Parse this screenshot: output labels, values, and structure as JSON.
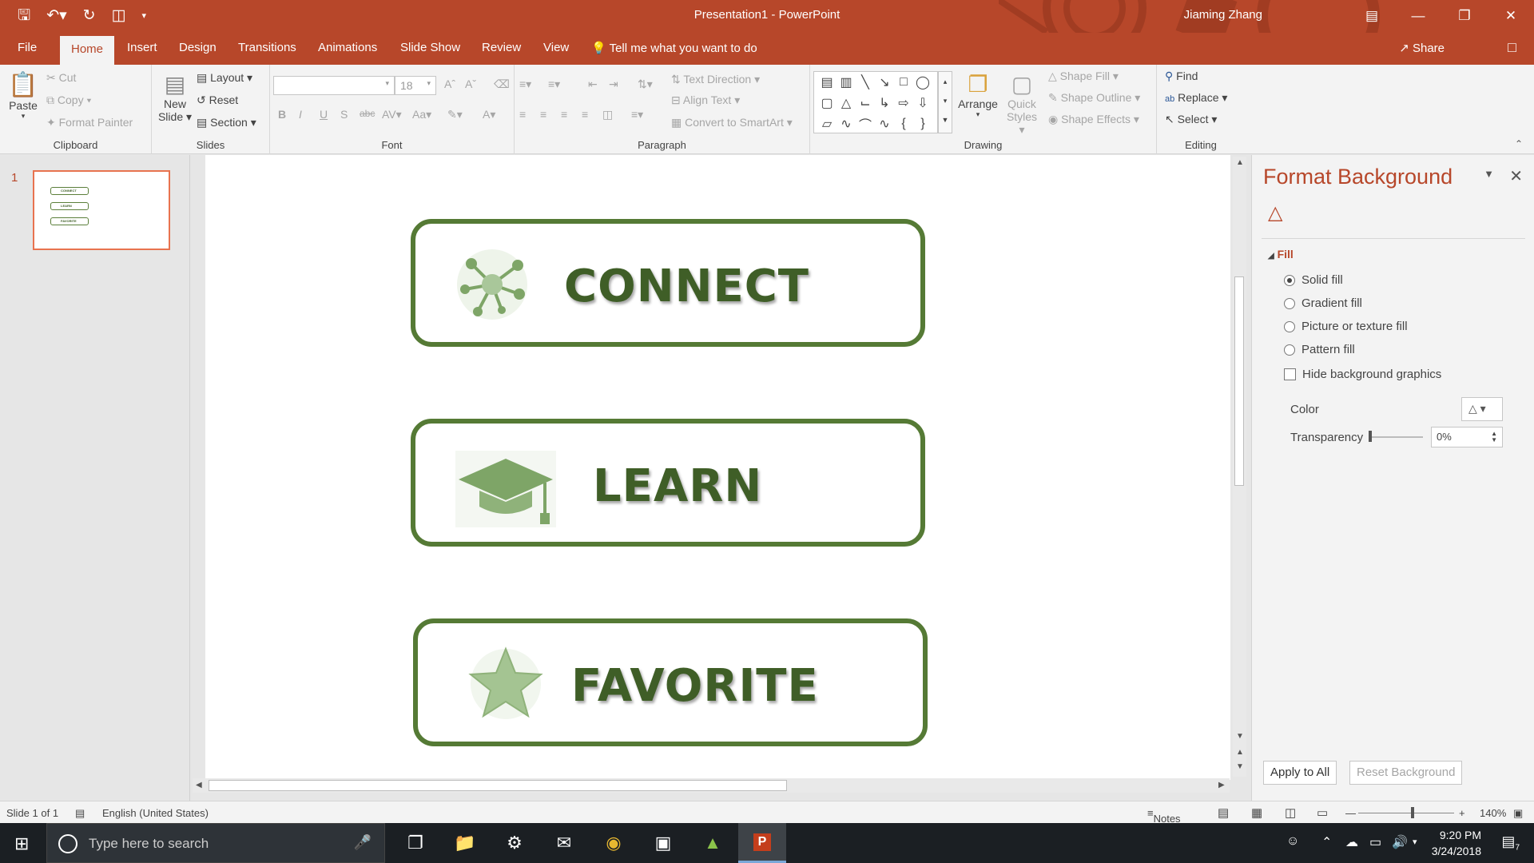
{
  "titlebar": {
    "title": "Presentation1  -  PowerPoint",
    "user": "Jiaming Zhang",
    "quick_access": [
      "save-icon",
      "undo-icon",
      "redo-icon",
      "start-from-beginning-icon",
      "customize-icon"
    ],
    "window_controls": [
      "ribbon-display-icon",
      "minimize-icon",
      "restore-icon",
      "close-icon"
    ]
  },
  "tabs": [
    "File",
    "Home",
    "Insert",
    "Design",
    "Transitions",
    "Animations",
    "Slide Show",
    "Review",
    "View"
  ],
  "active_tab": "Home",
  "tellme": "Tell me what you want to do",
  "share": "Share",
  "ribbon": {
    "clipboard": {
      "label": "Clipboard",
      "paste": "Paste",
      "cut": "Cut",
      "copy": "Copy",
      "format_painter": "Format Painter"
    },
    "slides": {
      "label": "Slides",
      "new_slide_1": "New",
      "new_slide_2": "Slide",
      "layout": "Layout",
      "reset": "Reset",
      "section": "Section"
    },
    "font": {
      "label": "Font",
      "font_name": "",
      "font_size": "18"
    },
    "paragraph": {
      "label": "Paragraph",
      "text_direction": "Text Direction",
      "align_text": "Align Text",
      "convert": "Convert to SmartArt"
    },
    "drawing": {
      "label": "Drawing",
      "arrange": "Arrange",
      "quick_styles_1": "Quick",
      "quick_styles_2": "Styles",
      "shape_fill": "Shape Fill",
      "shape_outline": "Shape Outline",
      "shape_effects": "Shape Effects"
    },
    "editing": {
      "label": "Editing",
      "find": "Find",
      "replace": "Replace",
      "select": "Select"
    }
  },
  "thumbnails": {
    "number": "1",
    "mini_labels": [
      "CONNECT",
      "LEARN",
      "FAVORITE"
    ]
  },
  "slide": {
    "cards": [
      {
        "label": "CONNECT",
        "icon": "network-icon"
      },
      {
        "label": "LEARN",
        "icon": "graduation-cap-icon"
      },
      {
        "label": "FAVORITE",
        "icon": "star-icon"
      }
    ]
  },
  "format_pane": {
    "title": "Format Background",
    "section": "Fill",
    "options": [
      "Solid fill",
      "Gradient fill",
      "Picture or texture fill",
      "Pattern fill"
    ],
    "selected": "Solid fill",
    "hide_graphics": "Hide background graphics",
    "color_label": "Color",
    "transparency_label": "Transparency",
    "transparency_value": "0%",
    "apply_all": "Apply to All",
    "reset_bg": "Reset Background"
  },
  "status": {
    "slide_info": "Slide 1 of 1",
    "language": "English (United States)",
    "notes": "Notes",
    "zoom": "140%"
  },
  "taskbar": {
    "search_placeholder": "Type here to search",
    "time": "9:20 PM",
    "date": "3/24/2018",
    "notif_count": "7"
  },
  "colors": {
    "accent": "#b7472a",
    "card_border": "#557a35",
    "card_text": "#3f5e27"
  }
}
